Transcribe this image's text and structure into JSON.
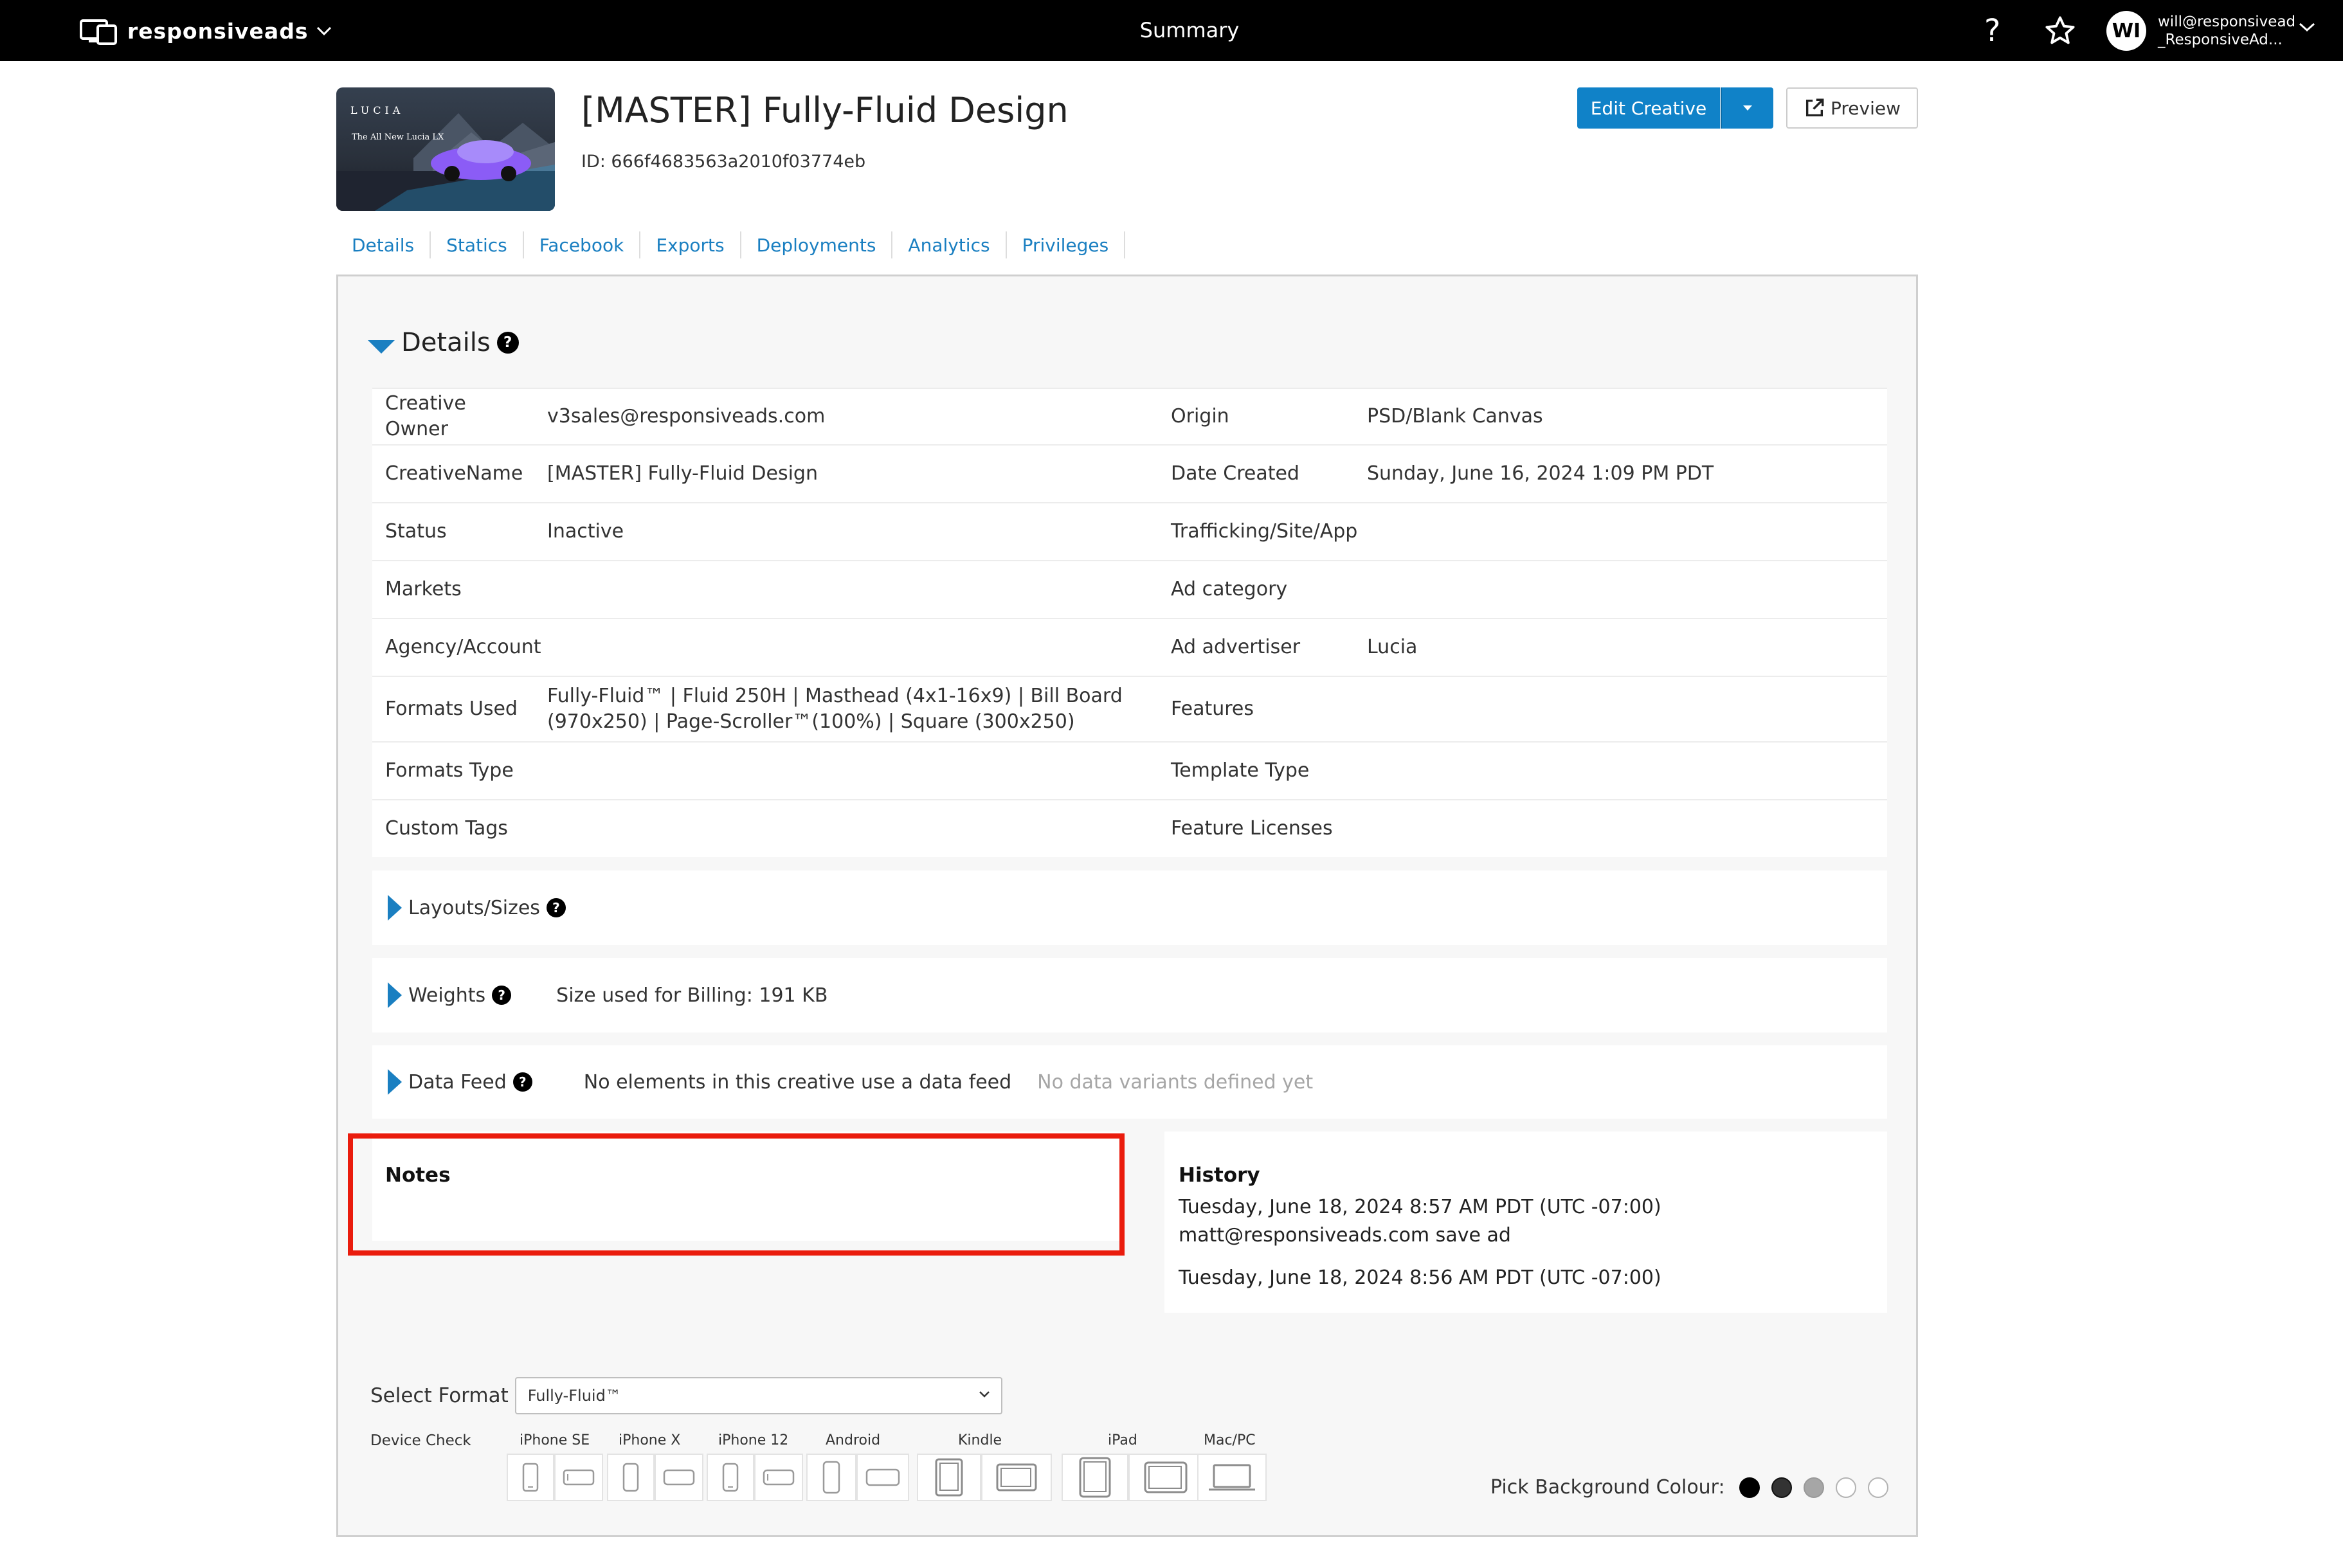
{
  "topbar": {
    "brand": "responsiveads",
    "title": "Summary",
    "help_icon": "?",
    "avatar_initials": "WI",
    "user_line1": "will@responsivead",
    "user_line2": "_ResponsiveAd..."
  },
  "creative": {
    "thumb_logo": "LUCIA",
    "thumb_headline": "The All New Lucia LX",
    "title": "[MASTER] Fully-Fluid Design",
    "id_text": "ID: 666f4683563a2010f03774eb",
    "edit_label": "Edit Creative",
    "preview_label": "Preview"
  },
  "tabs": [
    {
      "label": "Details"
    },
    {
      "label": "Statics"
    },
    {
      "label": "Facebook"
    },
    {
      "label": "Exports"
    },
    {
      "label": "Deployments"
    },
    {
      "label": "Analytics"
    },
    {
      "label": "Privileges"
    }
  ],
  "details": {
    "title": "Details",
    "rows": [
      {
        "l1": "Creative Owner",
        "v1": "v3sales@responsiveads.com",
        "l2": "Origin",
        "v2": "PSD/Blank Canvas"
      },
      {
        "l1": "CreativeName",
        "v1": "[MASTER] Fully-Fluid Design",
        "l2": "Date Created",
        "v2": "Sunday, June 16, 2024 1:09 PM PDT"
      },
      {
        "l1": "Status",
        "v1": "Inactive",
        "l2": "Trafficking/Site/App",
        "v2": ""
      },
      {
        "l1": "Markets",
        "v1": "",
        "l2": "Ad category",
        "v2": ""
      },
      {
        "l1": "Agency/Account",
        "v1": "",
        "l2": "Ad advertiser",
        "v2": "Lucia"
      },
      {
        "l1": "Formats Used",
        "v1": "Fully-Fluid™ | Fluid 250H | Masthead (4x1-16x9) | Bill Board (970x250) | Page-Scroller™(100%) | Square (300x250)",
        "l2": "Features",
        "v2": ""
      },
      {
        "l1": "Formats Type",
        "v1": "",
        "l2": "Template Type",
        "v2": ""
      },
      {
        "l1": "Custom Tags",
        "v1": "",
        "l2": "Feature Licenses",
        "v2": ""
      }
    ]
  },
  "layouts": {
    "label": "Layouts/Sizes"
  },
  "weights": {
    "label": "Weights",
    "billing": "Size used for Billing: 191 KB"
  },
  "datafeed": {
    "label": "Data Feed",
    "message": "No elements in this creative use a data feed",
    "variants": "No data variants defined yet"
  },
  "notes": {
    "title": "Notes"
  },
  "history": {
    "title": "History",
    "entries": [
      {
        "time": "Tuesday, June 18, 2024 8:57 AM PDT (UTC -07:00)",
        "action": "matt@responsiveads.com save ad"
      },
      {
        "time": "Tuesday, June 18, 2024 8:56 AM PDT (UTC -07:00)",
        "action": ""
      }
    ]
  },
  "format_select": {
    "label": "Select Format",
    "value": "Fully-Fluid™"
  },
  "device_check": {
    "label": "Device Check",
    "devices": [
      {
        "name": "iPhone SE"
      },
      {
        "name": "iPhone X"
      },
      {
        "name": "iPhone 12"
      },
      {
        "name": "Android"
      },
      {
        "name": "Kindle"
      },
      {
        "name": "iPad"
      },
      {
        "name": "Mac/PC"
      }
    ]
  },
  "background": {
    "label": "Pick Background Colour:",
    "colors": [
      "#000000",
      "#333333",
      "#a6a6a6",
      "#ffffff",
      "#ffffff"
    ]
  },
  "colors": {
    "accent": "#1082c8",
    "link": "#1a7fc1",
    "highlight": "#ea1c0d"
  }
}
